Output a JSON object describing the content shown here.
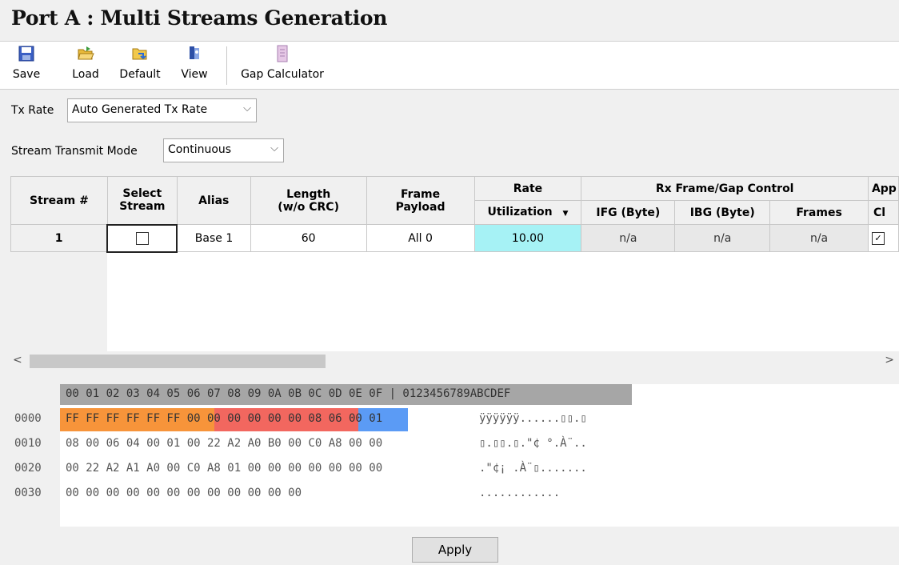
{
  "title": "Port A : Multi Streams Generation",
  "toolbar": {
    "save": "Save",
    "load": "Load",
    "default": "Default",
    "view": "View",
    "gap_calculator": "Gap Calculator"
  },
  "tx_rate": {
    "label": "Tx Rate",
    "value": "Auto Generated Tx Rate"
  },
  "transmit_mode": {
    "label": "Stream Transmit Mode",
    "value": "Continuous"
  },
  "table": {
    "headers": {
      "stream_no": "Stream #",
      "select_stream": "Select Stream",
      "alias": "Alias",
      "length": "Length (w/o CRC)",
      "frame_payload": "Frame Payload",
      "rate": "Rate",
      "utilization": "Utilization",
      "rx_gap_control": "Rx Frame/Gap Control",
      "ifg": "IFG (Byte)",
      "ibg": "IBG (Byte)",
      "frames": "Frames",
      "app_top": "App",
      "app_bottom": "Cl"
    },
    "rows": [
      {
        "stream_no": "1",
        "alias": "Base 1",
        "length": "60",
        "payload": "All 0",
        "utilization": "10.00",
        "ifg": "n/a",
        "ibg": "n/a",
        "frames": "n/a"
      }
    ]
  },
  "hex": {
    "header": "00 01 02 03 04 05 06 07 08 09 0A 0B 0C 0D 0E 0F | 0123456789ABCDEF",
    "lines": [
      {
        "offset": "0000",
        "hex": "FF FF FF FF FF FF 00 00 00 00 00 00 08 06 00 01",
        "ascii": "ÿÿÿÿÿÿ......▯▯.▯"
      },
      {
        "offset": "0010",
        "hex": "08 00 06 04 00 01 00 22 A2 A0 B0 00 C0 A8 00 00",
        "ascii": "▯.▯▯.▯.\"¢ °.À¨.."
      },
      {
        "offset": "0020",
        "hex": "00 22 A2 A1 A0 00 C0 A8 01 00 00 00 00 00 00 00",
        "ascii": ".\"¢¡ .À¨▯......."
      },
      {
        "offset": "0030",
        "hex": "00 00 00 00 00 00 00 00 00 00 00 00",
        "ascii": "............"
      }
    ],
    "colors": {
      "dest_mac": "#f7943a",
      "src_mac": "#f2675f",
      "ethertype": "#5b9bf5"
    }
  },
  "apply": "Apply",
  "icons": [
    "save-icon",
    "load-folder-icon",
    "default-icon",
    "view-icon",
    "gap-calculator-icon"
  ]
}
